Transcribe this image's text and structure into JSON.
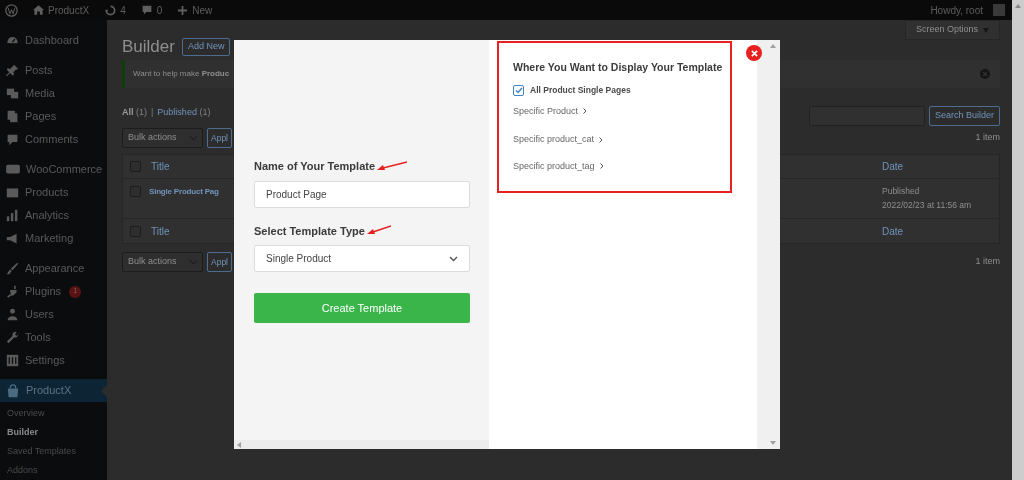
{
  "admin_bar": {
    "site_name": "ProductX",
    "updates": "4",
    "comments": "0",
    "new": "New",
    "greeting": "Howdy, root"
  },
  "sidebar": {
    "groups": [
      [
        {
          "label": "Dashboard",
          "selected": false
        }
      ],
      [
        {
          "label": "Posts",
          "selected": false
        },
        {
          "label": "Media",
          "selected": false
        },
        {
          "label": "Pages",
          "selected": false
        },
        {
          "label": "Comments",
          "selected": false
        }
      ],
      [
        {
          "label": "WooCommerce",
          "selected": false
        },
        {
          "label": "Products",
          "selected": false
        },
        {
          "label": "Analytics",
          "selected": false
        },
        {
          "label": "Marketing",
          "selected": false
        }
      ],
      [
        {
          "label": "Appearance",
          "selected": false
        },
        {
          "label": "Plugins",
          "selected": false,
          "badge": "1"
        },
        {
          "label": "Users",
          "selected": false
        },
        {
          "label": "Tools",
          "selected": false
        },
        {
          "label": "Settings",
          "selected": false
        }
      ],
      [
        {
          "label": "ProductX",
          "selected": true,
          "children": [
            {
              "label": "Overview",
              "selected": false
            },
            {
              "label": "Builder",
              "selected": true
            },
            {
              "label": "Saved Templates",
              "selected": false
            },
            {
              "label": "Addons",
              "selected": false
            }
          ]
        }
      ]
    ]
  },
  "page": {
    "title": "Builder",
    "add_new": "Add New",
    "screen_options": "Screen Options",
    "notice": "Want to help make **Produc**",
    "filter_separator": "|",
    "filters": [
      {
        "label": "All",
        "count": "(1)",
        "selected": true
      },
      {
        "label": "Published",
        "count": "(1)",
        "selected": false
      }
    ],
    "bulk_actions": [
      "Bulk actions",
      "Bulk actions"
    ],
    "apply": [
      "Appl",
      "Appl"
    ],
    "item_count": [
      "1 item",
      "1 item"
    ],
    "search_button": "Search Builder",
    "table": {
      "header": {
        "title": "Title",
        "date": "Date",
        "checked": false
      },
      "rows": [
        {
          "title": "Single Product Pag",
          "status": "Published",
          "date": "2022/02/23 at 11:56 am",
          "checked": false
        }
      ],
      "footer": {
        "title": "Title",
        "date": "Date",
        "checked": false
      }
    }
  },
  "modal": {
    "name_label": "Name of Your Template",
    "name_value": "Product Page",
    "type_label": "Select Template Type",
    "type_value": "Single Product",
    "create_button": "Create Template",
    "display": {
      "title": "Where You Want to Display Your Template",
      "options": [
        {
          "kind": "checkbox",
          "label": "All Product Single Pages",
          "checked": true
        },
        {
          "kind": "link",
          "label": "Specific Product"
        },
        {
          "kind": "link",
          "label": "Specific product_cat"
        },
        {
          "kind": "link",
          "label": "Specific product_tag"
        }
      ]
    }
  }
}
